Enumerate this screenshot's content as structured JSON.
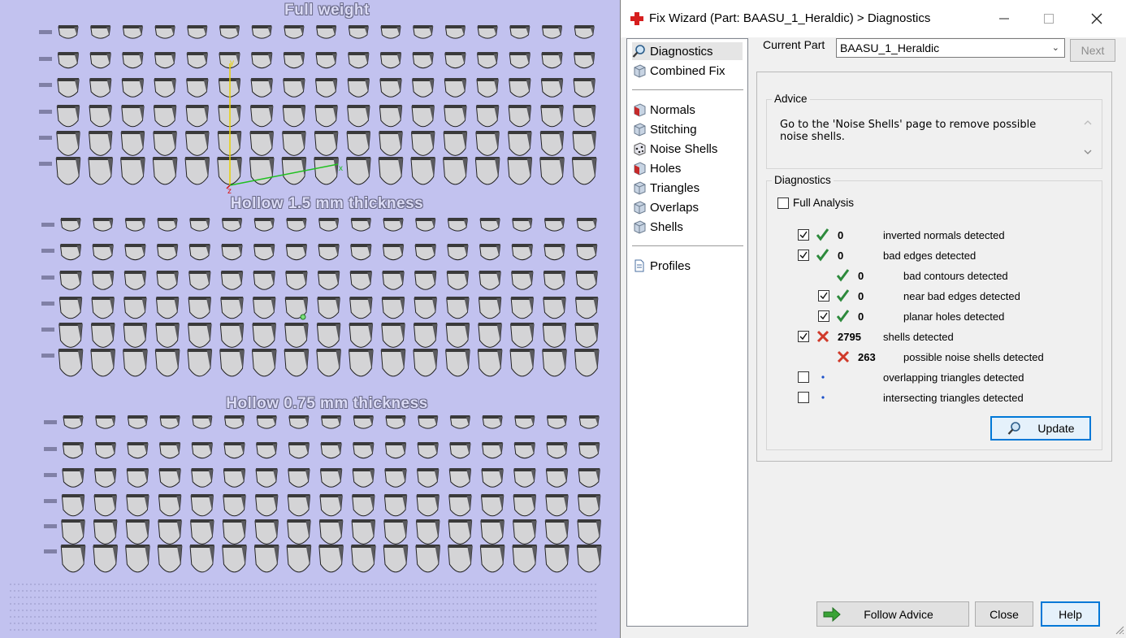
{
  "viewport": {
    "sections": [
      {
        "title": "Full weight"
      },
      {
        "title": "Hollow 1.5 mm thickness"
      },
      {
        "title": "Hollow 0.75 mm thickness"
      }
    ],
    "axes": {
      "x": "x",
      "y": "y",
      "z": "z"
    }
  },
  "window": {
    "title": "Fix Wizard (Part: BAASU_1_Heraldic) > Diagnostics",
    "minimize_symbol": "—",
    "maximize_symbol": "☐",
    "close_symbol": "✕"
  },
  "nav": {
    "group1": [
      {
        "label": "Diagnostics",
        "icon": "magnifier-icon",
        "selected": true
      },
      {
        "label": "Combined Fix",
        "icon": "cube-icon"
      }
    ],
    "group2": [
      {
        "label": "Normals",
        "icon": "normals-cube-icon"
      },
      {
        "label": "Stitching",
        "icon": "stitching-cube-icon"
      },
      {
        "label": "Noise Shells",
        "icon": "noise-shells-icon"
      },
      {
        "label": "Holes",
        "icon": "holes-cube-icon"
      },
      {
        "label": "Triangles",
        "icon": "triangles-cube-icon"
      },
      {
        "label": "Overlaps",
        "icon": "overlaps-cube-icon"
      },
      {
        "label": "Shells",
        "icon": "shells-cube-icon"
      }
    ],
    "group3": [
      {
        "label": "Profiles",
        "icon": "document-icon"
      }
    ]
  },
  "current_part": {
    "label": "Current Part",
    "value": "BAASU_1_Heraldic",
    "next_label": "Next"
  },
  "advice": {
    "label": "Advice",
    "text": "Go to the 'Noise Shells' page to remove possible noise shells."
  },
  "diagnostics": {
    "label": "Diagnostics",
    "full_analysis_label": "Full Analysis",
    "full_analysis_checked": false,
    "rows": [
      {
        "checkbox": true,
        "checked": true,
        "status": "ok",
        "count": "0",
        "label": "inverted normals detected",
        "indent": 0
      },
      {
        "checkbox": true,
        "checked": true,
        "status": "ok",
        "count": "0",
        "label": "bad edges detected",
        "indent": 0
      },
      {
        "checkbox": false,
        "checked": false,
        "status": "ok",
        "count": "0",
        "label": "bad contours detected",
        "indent": 1
      },
      {
        "checkbox": true,
        "checked": true,
        "status": "ok",
        "count": "0",
        "label": "near bad edges detected",
        "indent": 1
      },
      {
        "checkbox": true,
        "checked": true,
        "status": "ok",
        "count": "0",
        "label": "planar holes detected",
        "indent": 1
      },
      {
        "checkbox": true,
        "checked": true,
        "status": "error",
        "count": "2795",
        "label": "shells detected",
        "indent": 0
      },
      {
        "checkbox": false,
        "checked": false,
        "status": "error",
        "count": "263",
        "label": "possible noise shells detected",
        "indent": 1
      },
      {
        "checkbox": true,
        "checked": false,
        "status": "none",
        "count": "",
        "label": "overlapping triangles detected",
        "indent": 0
      },
      {
        "checkbox": true,
        "checked": false,
        "status": "none",
        "count": "",
        "label": "intersecting triangles detected",
        "indent": 0
      }
    ],
    "update_label": "Update"
  },
  "buttons": {
    "follow_advice": "Follow Advice",
    "close": "Close",
    "help": "Help"
  },
  "colors": {
    "viewport_bg": "#c2c2ef",
    "ok_green": "#2d8a3c",
    "error_red": "#d03a2a",
    "accent_blue": "#0078d7"
  }
}
